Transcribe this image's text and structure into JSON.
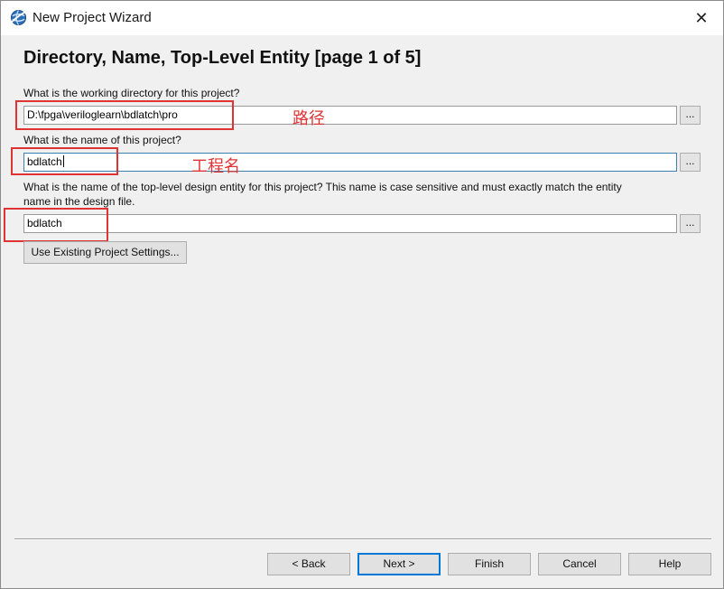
{
  "window": {
    "title": "New Project Wizard",
    "close_symbol": "✕"
  },
  "page": {
    "title": "Directory, Name, Top-Level Entity [page 1 of 5]"
  },
  "fields": {
    "directory": {
      "label": "What is the working directory for this project?",
      "value": "D:\\fpga\\veriloglearn\\bdlatch\\pro",
      "annotation": "路径"
    },
    "project_name": {
      "label": "What is the name of this project?",
      "value": "bdlatch",
      "annotation": "工程名"
    },
    "top_entity": {
      "label_line1": "What is the name of the top-level design entity for this project? This name is case sensitive and must exactly match the entity",
      "label_line2": "name in the design file.",
      "value": "bdlatch"
    },
    "browse_label": "..."
  },
  "buttons": {
    "use_existing": "Use Existing Project Settings...",
    "back": "< Back",
    "next": "Next >",
    "finish": "Finish",
    "cancel": "Cancel",
    "help": "Help"
  },
  "colors": {
    "annotation": "#e03434",
    "focus": "#3c7fb1",
    "default_button": "#0078d7"
  },
  "icons": {
    "app": "quartus-globe-icon",
    "close": "close-icon"
  }
}
